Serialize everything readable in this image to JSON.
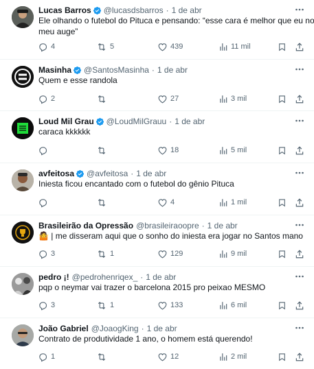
{
  "tweets": [
    {
      "name": "Lucas Barros",
      "verified": true,
      "handle": "@lucasdsbarros",
      "sep": "·",
      "time": "1 de abr",
      "text_line1": "Ele olhando o futebol do Pituca e pensando: “esse cara é melhor que eu no",
      "text_line2": "meu auge”",
      "replies": "4",
      "reposts": "5",
      "likes": "439",
      "views": "11 mil",
      "avatar_icon": "person-photo-icon"
    },
    {
      "name": "Masinha",
      "verified": true,
      "handle": "@SantosMasinha",
      "sep": "·",
      "time": "1 de abr",
      "text_line1": "Quem e esse randola",
      "replies": "2",
      "reposts": "",
      "likes": "27",
      "views": "3 mil",
      "avatar_icon": "santos-logo-icon"
    },
    {
      "name": "Loud Mil Grau",
      "verified": true,
      "handle": "@LoudMilGrauu",
      "sep": "·",
      "time": "1 de abr",
      "text_line1": "caraca kkkkkk",
      "replies": "",
      "reposts": "",
      "likes": "18",
      "views": "5 mil",
      "avatar_icon": "loud-logo-icon"
    },
    {
      "name": "avfeitosa",
      "verified": true,
      "handle": "@avfeitosa",
      "sep": "·",
      "time": "1 de abr",
      "text_line1": "Iniesta ficou encantado com o futebol do gênio Pituca",
      "replies": "",
      "reposts": "",
      "likes": "4",
      "views": "1 mil",
      "avatar_icon": "person-photo-icon"
    },
    {
      "name": "Brasileirão da Opressão",
      "verified": false,
      "handle": "@brasileiraoopre",
      "sep": "·",
      "time": "1 de abr",
      "emoji": "🤷",
      "text_line1": "| me disseram aqui que o sonho do iniesta era jogar no Santos mano",
      "replies": "3",
      "reposts": "1",
      "likes": "129",
      "views": "9 mil",
      "avatar_icon": "trophy-logo-icon"
    },
    {
      "name": "pedro ¡!",
      "verified": false,
      "handle": "@pedrohenriqex_",
      "sep": "·",
      "time": "1 de abr",
      "text_line1": "pqp o neymar vai trazer o barcelona 2015 pro peixao MESMO",
      "replies": "3",
      "reposts": "1",
      "likes": "133",
      "views": "6 mil",
      "avatar_icon": "person-photo-icon"
    },
    {
      "name": "João Gabriel",
      "verified": false,
      "handle": "@JoaogKing",
      "sep": "·",
      "time": "1 de abr",
      "text_line1": "Contrato de produtividade 1 ano, o homem está querendo!",
      "replies": "1",
      "reposts": "",
      "likes": "12",
      "views": "2 mil",
      "avatar_icon": "person-photo-icon"
    }
  ],
  "colors": {
    "text": "#0f1419",
    "secondary": "#536471",
    "verified": "#1d9bf0",
    "divider": "#eff3f4"
  }
}
